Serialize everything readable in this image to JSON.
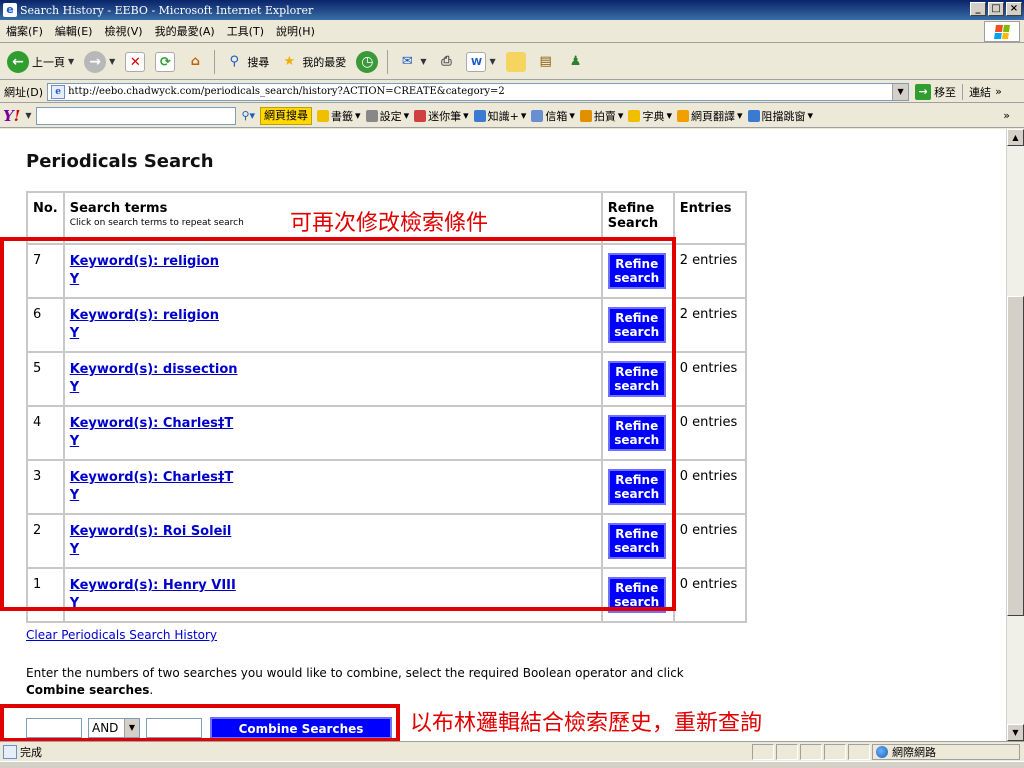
{
  "window": {
    "title": "Search History - EEBO - Microsoft Internet Explorer"
  },
  "menu": [
    "檔案(F)",
    "編輯(E)",
    "檢視(V)",
    "我的最愛(A)",
    "工具(T)",
    "說明(H)"
  ],
  "toolbar": {
    "back": "上一頁",
    "search": "搜尋",
    "favorites": "我的最愛"
  },
  "address": {
    "label": "網址(D)",
    "url": "http://eebo.chadwyck.com/periodicals_search/history?ACTION=CREATE&category=2",
    "go": "移至",
    "links": "連結"
  },
  "yahoo": {
    "search_button": "網頁搜尋",
    "items": [
      "書籤",
      "設定",
      "迷你筆",
      "知識+",
      "信箱",
      "拍賣",
      "字典",
      "網頁翻譯",
      "阻擋跳窗"
    ]
  },
  "page": {
    "heading": "Periodicals Search",
    "table": {
      "headers": {
        "no": "No.",
        "terms": "Search terms",
        "terms_sub": "Click on search terms to repeat search",
        "refine": "Refine Search",
        "entries": "Entries"
      },
      "rows": [
        {
          "no": "7",
          "keyword": "Keyword(s): religion",
          "sub": "Y",
          "refine": "Refine search",
          "entries": "2 entries"
        },
        {
          "no": "6",
          "keyword": "Keyword(s): religion",
          "sub": "Y",
          "refine": "Refine search",
          "entries": "2 entries"
        },
        {
          "no": "5",
          "keyword": "Keyword(s): dissection",
          "sub": "Y",
          "refine": "Refine search",
          "entries": "0 entries"
        },
        {
          "no": "4",
          "keyword": "Keyword(s): Charles‡T",
          "sub": "Y",
          "refine": "Refine search",
          "entries": "0 entries"
        },
        {
          "no": "3",
          "keyword": "Keyword(s): Charles‡T",
          "sub": "Y",
          "refine": "Refine search",
          "entries": "0 entries"
        },
        {
          "no": "2",
          "keyword": "Keyword(s): Roi Soleil",
          "sub": "Y",
          "refine": "Refine search",
          "entries": "0 entries"
        },
        {
          "no": "1",
          "keyword": "Keyword(s): Henry VIII",
          "sub": "Y",
          "refine": "Refine search",
          "entries": "0 entries"
        }
      ]
    },
    "clear_link": "Clear Periodicals Search History",
    "instructions": "Enter the numbers of two searches you would like to combine, select the required Boolean operator and click",
    "instructions_bold": "Combine searches",
    "operator": "AND",
    "combine_button": "Combine Searches"
  },
  "annotations": {
    "top": "可再次修改檢索條件",
    "bottom": "以布林邏輯結合檢索歷史，重新查詢"
  },
  "status": {
    "left": "完成",
    "zone": "網際網路"
  },
  "colors": {
    "annotation": "#e00000",
    "button": "#0000ff",
    "link": "#0000cc"
  }
}
